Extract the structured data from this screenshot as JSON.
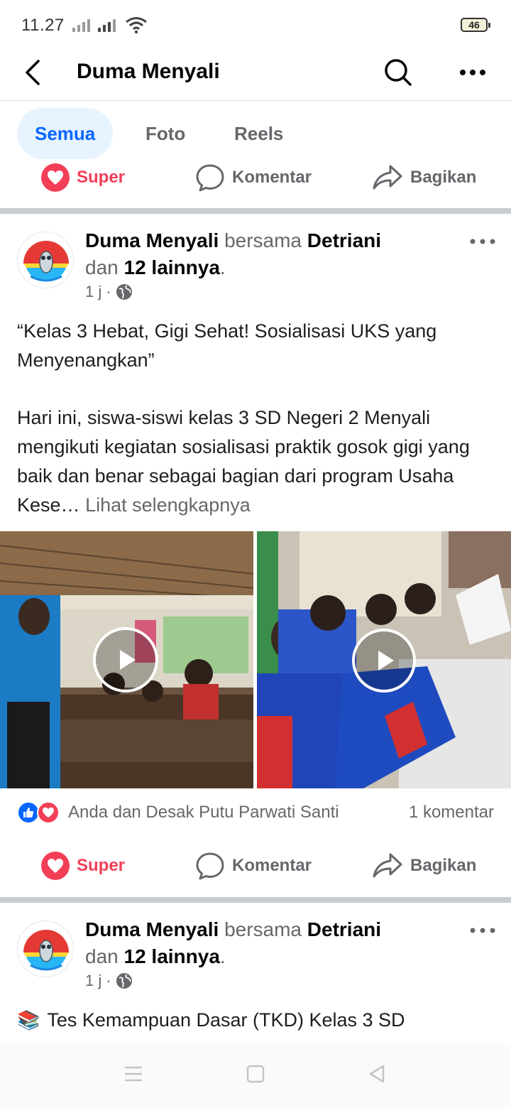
{
  "status_bar": {
    "time": "11.27",
    "battery": "46"
  },
  "header": {
    "title": "Duma Menyali"
  },
  "tabs": [
    {
      "label": "Semua",
      "active": true
    },
    {
      "label": "Foto",
      "active": false
    },
    {
      "label": "Reels",
      "active": false
    }
  ],
  "actions": {
    "super": "Super",
    "comment": "Komentar",
    "share": "Bagikan"
  },
  "posts": [
    {
      "author": "Duma Menyali",
      "with_word": "bersama",
      "tagged": "Detriani",
      "and_word": "dan",
      "others": "12 lainnya",
      "time": "1 j",
      "title_text": "“Kelas 3 Hebat, Gigi Sehat! Sosialisasi UKS yang Menyenangkan”",
      "body_text": "Hari ini, siswa-siswi kelas 3 SD Negeri 2 Menyali mengikuti kegiatan sosialisasi praktik gosok gigi yang baik dan benar sebagai bagian dari program Usaha Kese…",
      "see_more": "Lihat selengkapnya",
      "reactions_text": "Anda dan Desak Putu Parwati Santi",
      "comment_count": "1 komentar"
    },
    {
      "author": "Duma Menyali",
      "with_word": "bersama",
      "tagged": "Detriani",
      "and_word": "dan",
      "others": "12 lainnya",
      "time": "1 j",
      "title_emoji": "📚",
      "title_text": "Tes Kemampuan Dasar (TKD) Kelas 3 SD"
    }
  ],
  "colors": {
    "accent": "#0866ff",
    "super": "#f33e58",
    "muted": "#65676b"
  }
}
